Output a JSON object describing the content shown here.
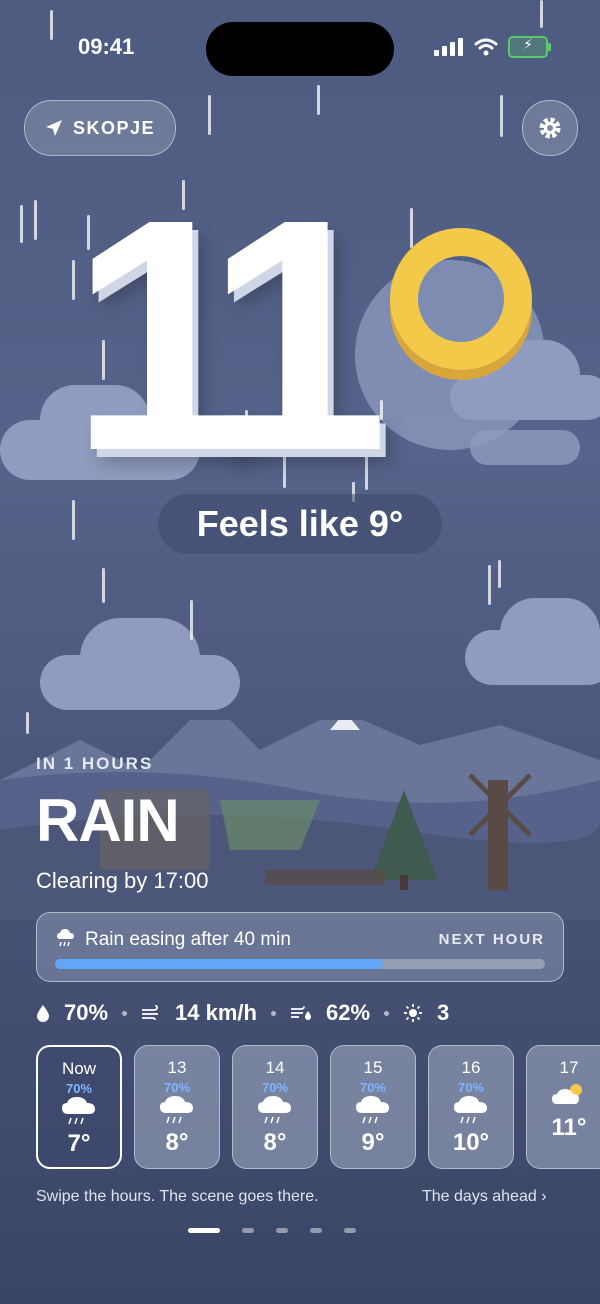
{
  "status_bar": {
    "time": "09:41"
  },
  "location": {
    "name": "SKOPJE"
  },
  "current": {
    "temperature": "11",
    "feels_like": "Feels like 9°"
  },
  "forecast": {
    "in_hours": "IN 1 HOURS",
    "condition": "RAIN",
    "clearing": "Clearing by 17:00"
  },
  "next_hour": {
    "text": "Rain easing after 40 min",
    "label": "NEXT HOUR",
    "progress_percent": 67
  },
  "stats": {
    "humidity": "70%",
    "wind": "14 km/h",
    "precip": "62%",
    "uv": "3"
  },
  "hours": [
    {
      "hour": "Now",
      "precip": "70%",
      "temp": "7°",
      "icon": "rain-cloud-icon"
    },
    {
      "hour": "13",
      "precip": "70%",
      "temp": "8°",
      "icon": "rain-cloud-icon"
    },
    {
      "hour": "14",
      "precip": "70%",
      "temp": "8°",
      "icon": "rain-cloud-icon"
    },
    {
      "hour": "15",
      "precip": "70%",
      "temp": "9°",
      "icon": "rain-cloud-icon"
    },
    {
      "hour": "16",
      "precip": "70%",
      "temp": "10°",
      "icon": "rain-cloud-icon"
    },
    {
      "hour": "17",
      "precip": "",
      "temp": "11°",
      "icon": "partly-cloudy-icon"
    }
  ],
  "footer": {
    "hint": "Swipe the hours. The scene goes there.",
    "days_ahead": "The days ahead"
  },
  "colors": {
    "accent": "#62a6f7",
    "degree": "#f3c94a",
    "battery": "#5ac86b"
  }
}
